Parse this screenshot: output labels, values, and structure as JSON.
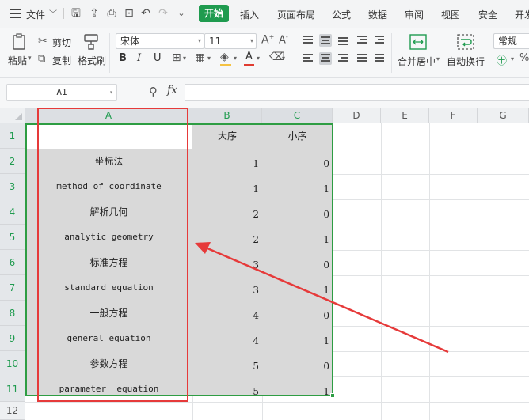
{
  "menu": {
    "file": "文件",
    "tabs": [
      "开始",
      "插入",
      "页面布局",
      "公式",
      "数据",
      "审阅",
      "视图",
      "安全",
      "开发"
    ]
  },
  "ribbon": {
    "paste": "粘贴",
    "cut": "剪切",
    "copy": "复制",
    "format_painter": "格式刷",
    "font_name": "宋体",
    "font_size": "11",
    "bold": "B",
    "italic": "I",
    "underline": "U",
    "merge_center": "合并居中",
    "wrap_text": "自动换行",
    "number_format": "常规",
    "font_color": "#e03c31",
    "fill_color": "#f5c242"
  },
  "formula_bar": {
    "cell_ref": "A1",
    "fx": "fx",
    "content": ""
  },
  "columns": [
    "A",
    "B",
    "C",
    "D",
    "E",
    "F",
    "G"
  ],
  "rows": [
    "1",
    "2",
    "3",
    "4",
    "5",
    "6",
    "7",
    "8",
    "9",
    "10",
    "11",
    "12"
  ],
  "table": {
    "headers": [
      "",
      "大序",
      "小序"
    ],
    "data": [
      [
        "坐标法",
        "1",
        "0"
      ],
      [
        "method of coordinate",
        "1",
        "1"
      ],
      [
        "解析几何",
        "2",
        "0"
      ],
      [
        "analytic geometry",
        "2",
        "1"
      ],
      [
        "标准方程",
        "3",
        "0"
      ],
      [
        "standard equation",
        "3",
        "1"
      ],
      [
        "一般方程",
        "4",
        "0"
      ],
      [
        "general equation",
        "4",
        "1"
      ],
      [
        "参数方程",
        "5",
        "0"
      ],
      [
        "parameter  equation",
        "5",
        "1"
      ]
    ]
  },
  "colors": {
    "accent": "#1f9b4f",
    "selection_border": "#2e9d43",
    "annotation": "#e63a3a"
  }
}
